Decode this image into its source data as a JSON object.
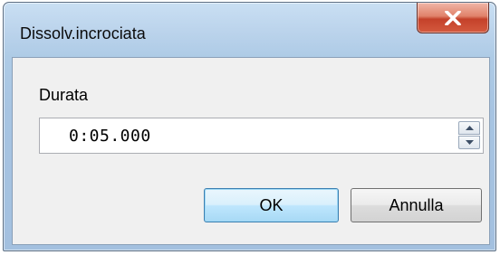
{
  "window": {
    "title": "Dissolv.incrociata",
    "close_icon": "close-icon"
  },
  "form": {
    "duration_label": "Durata",
    "duration_value": "0:05.000",
    "spin_up_icon": "spin-up-icon",
    "spin_down_icon": "spin-down-icon"
  },
  "buttons": {
    "ok_label": "OK",
    "cancel_label": "Annulla"
  },
  "colors": {
    "close_button": "#c4412a",
    "default_button_border": "#3c7fb1",
    "frame": "#a3c0df"
  }
}
